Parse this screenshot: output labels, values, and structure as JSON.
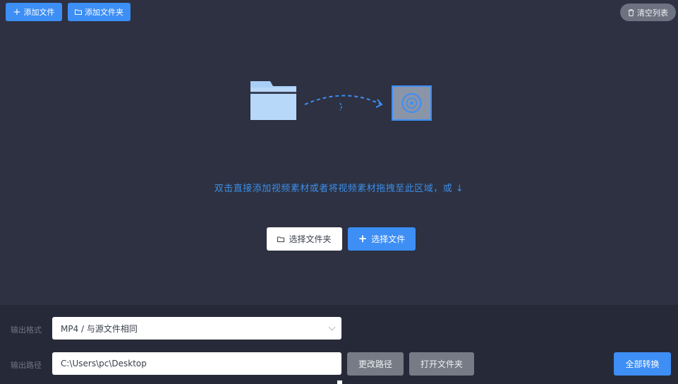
{
  "toolbar": {
    "add_file_label": "添加文件",
    "add_folder_label": "添加文件夹",
    "clear_list_label": "清空列表"
  },
  "drop_zone": {
    "hint_text": "双击直接添加视频素材或者将视频素材拖拽至此区域，或 ↓",
    "select_folder_label": "选择文件夹",
    "select_file_label": "选择文件"
  },
  "output": {
    "format_label": "输出格式",
    "format_value": "MP4 / 与源文件相同",
    "path_label": "输出路径",
    "path_value": "C:\\Users\\pc\\Desktop",
    "change_path_label": "更改路径",
    "open_folder_label": "打开文件夹",
    "convert_all_label": "全部转换"
  },
  "colors": {
    "background": "#2d3142",
    "accent": "#3d8ef5",
    "hint": "#3b8ee8",
    "bottom_panel": "#262a38"
  },
  "icons": {
    "add_file": "plus-icon",
    "add_folder": "folder-icon",
    "clear_list": "trash-icon",
    "illustration_source": "folder-icon",
    "illustration_target": "video-icon"
  }
}
